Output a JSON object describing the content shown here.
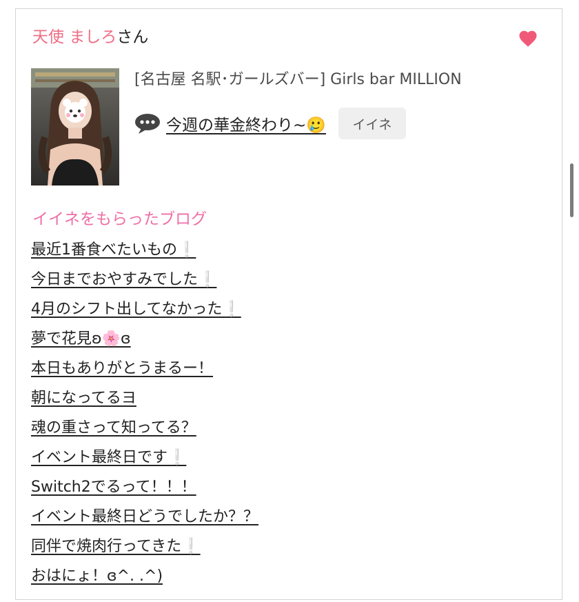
{
  "profile": {
    "name": "天使 ましろ",
    "honorific": "さん",
    "shop": "[名古屋 名駅･ガールズバー]  Girls bar MILLION"
  },
  "latest_post": {
    "title": "今週の華金終わり~🥲",
    "like_button": "イイネ"
  },
  "liked_blogs": {
    "heading": "イイネをもらったブログ",
    "items": [
      "最近1番食べたいもの❕",
      "今日までおやすみでした❕",
      "4月のシフト出してなかった❕",
      "夢で花見ʚ🌸ɞ",
      "本日もありがとうまるー！",
      "朝になってるヨ",
      "魂の重さって知ってる？",
      "イベント最終日です❕",
      "Switch2でるって！！！",
      "イベント最終日どうでしたか？？",
      "同伴で焼肉行ってきた❕",
      "おはにょ！ɞ^.  .^)"
    ]
  },
  "colors": {
    "name_pink": "#ef6e86",
    "heading_pink": "#ef6fa7",
    "heart": "#f05a78"
  },
  "icons": [
    "heart-icon",
    "speech-bubble-icon"
  ]
}
